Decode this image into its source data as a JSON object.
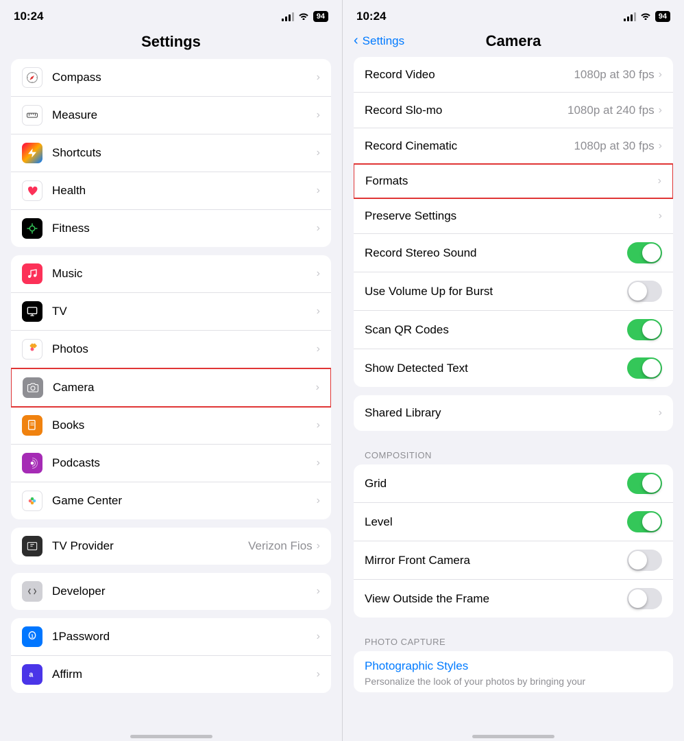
{
  "left": {
    "status": {
      "time": "10:24",
      "battery": "94"
    },
    "title": "Settings",
    "groups": [
      {
        "items": [
          {
            "id": "compass",
            "icon": "🧭",
            "iconBg": "icon-compass",
            "label": "Compass",
            "value": "",
            "chevron": true
          },
          {
            "id": "measure",
            "icon": "📏",
            "iconBg": "icon-measure",
            "label": "Measure",
            "value": "",
            "chevron": true
          },
          {
            "id": "shortcuts",
            "icon": "⬡",
            "iconBg": "icon-shortcuts",
            "label": "Shortcuts",
            "value": "",
            "chevron": true
          },
          {
            "id": "health",
            "icon": "❤️",
            "iconBg": "icon-health",
            "label": "Health",
            "value": "",
            "chevron": true
          },
          {
            "id": "fitness",
            "icon": "⬤",
            "iconBg": "icon-fitness",
            "label": "Fitness",
            "value": "",
            "chevron": true
          }
        ]
      },
      {
        "items": [
          {
            "id": "music",
            "icon": "♪",
            "iconBg": "icon-music",
            "label": "Music",
            "value": "",
            "chevron": true
          },
          {
            "id": "tv",
            "icon": "tv",
            "iconBg": "icon-tv",
            "label": "TV",
            "value": "",
            "chevron": true
          },
          {
            "id": "photos",
            "icon": "✿",
            "iconBg": "icon-photos",
            "label": "Photos",
            "value": "",
            "chevron": true
          },
          {
            "id": "camera",
            "icon": "⊙",
            "iconBg": "icon-camera",
            "label": "Camera",
            "value": "",
            "chevron": true,
            "highlighted": true
          },
          {
            "id": "books",
            "icon": "□",
            "iconBg": "icon-books",
            "label": "Books",
            "value": "",
            "chevron": true
          },
          {
            "id": "podcasts",
            "icon": "◎",
            "iconBg": "icon-podcasts",
            "label": "Podcasts",
            "value": "",
            "chevron": true
          },
          {
            "id": "gamecenter",
            "icon": "✦",
            "iconBg": "icon-gamecenter",
            "label": "Game Center",
            "value": "",
            "chevron": true
          }
        ]
      },
      {
        "items": [
          {
            "id": "tvprovider",
            "icon": "$",
            "iconBg": "icon-tvprovider",
            "label": "TV Provider",
            "value": "Verizon Fios",
            "chevron": true
          }
        ]
      },
      {
        "items": [
          {
            "id": "developer",
            "icon": "⚒",
            "iconBg": "icon-developer",
            "label": "Developer",
            "value": "",
            "chevron": true
          }
        ]
      },
      {
        "items": [
          {
            "id": "1password",
            "icon": "①",
            "iconBg": "icon-1password",
            "label": "1Password",
            "value": "",
            "chevron": true
          },
          {
            "id": "affirm",
            "icon": "a",
            "iconBg": "icon-affirm",
            "label": "Affirm",
            "value": "",
            "chevron": true
          }
        ]
      }
    ]
  },
  "right": {
    "status": {
      "time": "10:24",
      "battery": "94"
    },
    "backLabel": "Settings",
    "title": "Camera",
    "sections": [
      {
        "label": "",
        "items": [
          {
            "id": "record-video",
            "label": "Record Video",
            "value": "1080p at 30 fps",
            "toggle": null,
            "chevron": true
          },
          {
            "id": "record-slomo",
            "label": "Record Slo-mo",
            "value": "1080p at 240 fps",
            "toggle": null,
            "chevron": true
          },
          {
            "id": "record-cinematic",
            "label": "Record Cinematic",
            "value": "1080p at 30 fps",
            "toggle": null,
            "chevron": true
          },
          {
            "id": "formats",
            "label": "Formats",
            "value": "",
            "toggle": null,
            "chevron": true,
            "highlighted": true
          },
          {
            "id": "preserve-settings",
            "label": "Preserve Settings",
            "value": "",
            "toggle": null,
            "chevron": true
          },
          {
            "id": "record-stereo",
            "label": "Record Stereo Sound",
            "value": "",
            "toggle": "on",
            "chevron": false
          },
          {
            "id": "volume-burst",
            "label": "Use Volume Up for Burst",
            "value": "",
            "toggle": "off",
            "chevron": false
          },
          {
            "id": "scan-qr",
            "label": "Scan QR Codes",
            "value": "",
            "toggle": "on",
            "chevron": false
          },
          {
            "id": "show-detected",
            "label": "Show Detected Text",
            "value": "",
            "toggle": "on",
            "chevron": false
          }
        ]
      },
      {
        "label": "",
        "items": [
          {
            "id": "shared-library",
            "label": "Shared Library",
            "value": "",
            "toggle": null,
            "chevron": true
          }
        ]
      },
      {
        "label": "COMPOSITION",
        "items": [
          {
            "id": "grid",
            "label": "Grid",
            "value": "",
            "toggle": "on",
            "chevron": false
          },
          {
            "id": "level",
            "label": "Level",
            "value": "",
            "toggle": "on",
            "chevron": false
          },
          {
            "id": "mirror-front",
            "label": "Mirror Front Camera",
            "value": "",
            "toggle": "off",
            "chevron": false
          },
          {
            "id": "view-outside",
            "label": "View Outside the Frame",
            "value": "",
            "toggle": "off",
            "chevron": false
          }
        ]
      },
      {
        "label": "PHOTO CAPTURE",
        "items": [
          {
            "id": "photographic-styles",
            "label": "Photographic Styles",
            "value": "",
            "toggle": null,
            "chevron": false,
            "blue": true
          }
        ]
      }
    ],
    "photoCaptureDescription": "Personalize the look of your photos by bringing your"
  }
}
